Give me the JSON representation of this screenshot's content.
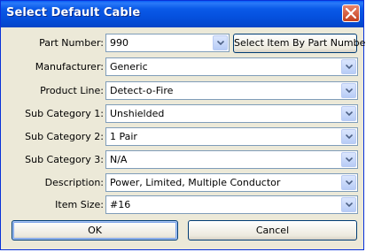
{
  "window": {
    "title": "Select Default Cable"
  },
  "fields": [
    {
      "label": "Part Number:",
      "value": "990"
    },
    {
      "label": "Manufacturer:",
      "value": "Generic"
    },
    {
      "label": "Product Line:",
      "value": "Detect-o-Fire"
    },
    {
      "label": "Sub Category 1:",
      "value": "Unshielded"
    },
    {
      "label": "Sub Category 2:",
      "value": "1 Pair"
    },
    {
      "label": "Sub Category 3:",
      "value": "N/A"
    },
    {
      "label": "Description:",
      "value": "Power, Limited, Multiple Conductor"
    },
    {
      "label": "Item Size:",
      "value": "#16"
    }
  ],
  "buttons": {
    "select_by_part": "Select Item By Part Number",
    "ok": "OK",
    "cancel": "Cancel"
  },
  "icons": {
    "close": "close-icon",
    "dropdown": "chevron-down-icon"
  },
  "colors": {
    "titlebar": "#0551de",
    "dialog_bg": "#ece9d8",
    "close_button": "#c3401e"
  }
}
